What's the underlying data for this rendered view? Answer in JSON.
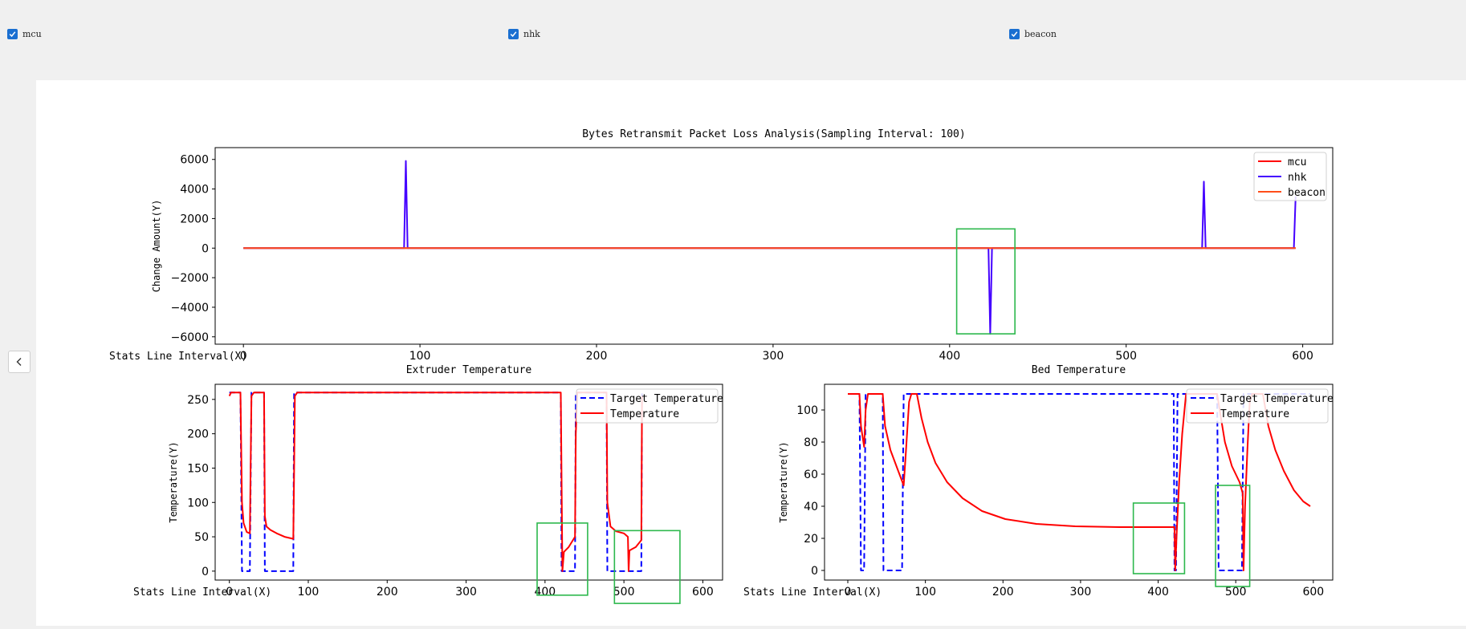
{
  "toolbar": {
    "checkboxes": [
      {
        "label": "mcu",
        "checked": true
      },
      {
        "label": "nhk",
        "checked": true
      },
      {
        "label": "beacon",
        "checked": true
      }
    ]
  },
  "collapse_icon": "chevron-left-icon",
  "colors": {
    "mcu": "#ff0000",
    "nhk": "#4400ff",
    "beacon": "#ff4d1a",
    "target": "#0000ff",
    "highlight": "#2db84d"
  },
  "chart_data": [
    {
      "type": "line",
      "title": "Bytes Retransmit Packet Loss Analysis(Sampling Interval: 100)",
      "xlabel": "Stats Line Interval(X)",
      "ylabel": "Change Amount(Y)",
      "xlim": [
        -16,
        617
      ],
      "ylim": [
        -6500,
        6800
      ],
      "xticks": [
        0,
        100,
        200,
        300,
        400,
        500,
        600
      ],
      "yticks": [
        -6000,
        -4000,
        -2000,
        0,
        2000,
        4000,
        6000
      ],
      "legend": "top-right",
      "series": [
        {
          "name": "mcu",
          "color": "#ff0000",
          "style": "solid",
          "points": [
            [
              0,
              0
            ],
            [
              596,
              0
            ]
          ]
        },
        {
          "name": "nhk",
          "color": "#4400ff",
          "style": "solid",
          "points": [
            [
              0,
              0
            ],
            [
              91,
              0
            ],
            [
              92,
              5900
            ],
            [
              93,
              0
            ],
            [
              422,
              0
            ],
            [
              423,
              -5800
            ],
            [
              424,
              0
            ],
            [
              543,
              0
            ],
            [
              544,
              4500
            ],
            [
              545,
              0
            ],
            [
              595,
              0
            ],
            [
              596,
              3500
            ]
          ]
        },
        {
          "name": "beacon",
          "color": "#ff4d1a",
          "style": "solid",
          "points": [
            [
              0,
              0
            ],
            [
              596,
              0
            ]
          ]
        }
      ],
      "highlights": [
        {
          "x0": 404,
          "x1": 437,
          "y0": -5800,
          "y1": 1300
        }
      ]
    },
    {
      "type": "line",
      "title": "Extruder Temperature",
      "xlabel": "Stats Line Interval(X)",
      "ylabel": "Temperature(Y)",
      "xlim": [
        -18,
        625
      ],
      "ylim": [
        -13,
        272
      ],
      "xticks": [
        0,
        100,
        200,
        300,
        400,
        500,
        600
      ],
      "yticks": [
        0,
        50,
        100,
        150,
        200,
        250
      ],
      "legend": "top-right",
      "series": [
        {
          "name": "Target Temperature",
          "color": "#0000ff",
          "style": "dashed",
          "points": [
            [
              0,
              260
            ],
            [
              14,
              260
            ],
            [
              16,
              0
            ],
            [
              26,
              0
            ],
            [
              28,
              260
            ],
            [
              44,
              260
            ],
            [
              45,
              0
            ],
            [
              81,
              0
            ],
            [
              82,
              260
            ],
            [
              420,
              260
            ],
            [
              421,
              0
            ],
            [
              438,
              0
            ],
            [
              439,
              260
            ],
            [
              478,
              260
            ],
            [
              479,
              0
            ],
            [
              522,
              0
            ],
            [
              523,
              260
            ]
          ]
        },
        {
          "name": "Temperature",
          "color": "#ff0000",
          "style": "solid",
          "points": [
            [
              0,
              255
            ],
            [
              2,
              260
            ],
            [
              14,
              260
            ],
            [
              16,
              100
            ],
            [
              18,
              70
            ],
            [
              22,
              57
            ],
            [
              26,
              55
            ],
            [
              28,
              255
            ],
            [
              31,
              260
            ],
            [
              44,
              260
            ],
            [
              45,
              80
            ],
            [
              47,
              65
            ],
            [
              52,
              60
            ],
            [
              60,
              55
            ],
            [
              70,
              50
            ],
            [
              81,
              47
            ],
            [
              82,
              140
            ],
            [
              83,
              255
            ],
            [
              86,
              260
            ],
            [
              420,
              260
            ],
            [
              422,
              0
            ],
            [
              424,
              28
            ],
            [
              430,
              35
            ],
            [
              438,
              50
            ],
            [
              439,
              200
            ],
            [
              441,
              260
            ],
            [
              478,
              260
            ],
            [
              479,
              100
            ],
            [
              483,
              65
            ],
            [
              490,
              58
            ],
            [
              500,
              55
            ],
            [
              505,
              50
            ],
            [
              506,
              0
            ],
            [
              507,
              30
            ],
            [
              510,
              32
            ],
            [
              515,
              35
            ],
            [
              522,
              45
            ],
            [
              523,
              255
            ]
          ]
        }
      ],
      "highlights": [
        {
          "x0": 390,
          "x1": 454,
          "y0": -35,
          "y1": 70
        },
        {
          "x0": 488,
          "x1": 571,
          "y0": -47,
          "y1": 59
        }
      ]
    },
    {
      "type": "line",
      "title": "Bed Temperature",
      "xlabel": "Stats Line Interval(X)",
      "ylabel": "Temperature(Y)",
      "xlim": [
        -30,
        625
      ],
      "ylim": [
        -6,
        116
      ],
      "xticks": [
        0,
        100,
        200,
        300,
        400,
        500,
        600
      ],
      "yticks": [
        0,
        20,
        40,
        60,
        80,
        100
      ],
      "legend": "top-right",
      "series": [
        {
          "name": "Target Temperature",
          "color": "#0000ff",
          "style": "dashed",
          "points": [
            [
              0,
              110
            ],
            [
              15,
              110
            ],
            [
              17,
              0
            ],
            [
              21,
              0
            ],
            [
              23,
              110
            ],
            [
              45,
              110
            ],
            [
              46,
              0
            ],
            [
              70,
              0
            ],
            [
              72,
              110
            ],
            [
              420,
              110
            ],
            [
              421,
              0
            ],
            [
              423,
              0
            ],
            [
              425,
              110
            ],
            [
              476,
              110
            ],
            [
              478,
              0
            ],
            [
              508,
              0
            ],
            [
              510,
              110
            ],
            [
              596,
              110
            ]
          ]
        },
        {
          "name": "Temperature",
          "color": "#ff0000",
          "style": "solid",
          "points": [
            [
              0,
              110
            ],
            [
              15,
              110
            ],
            [
              17,
              90
            ],
            [
              21,
              77
            ],
            [
              23,
              100
            ],
            [
              26,
              110
            ],
            [
              45,
              110
            ],
            [
              48,
              90
            ],
            [
              55,
              75
            ],
            [
              65,
              62
            ],
            [
              72,
              53
            ],
            [
              75,
              75
            ],
            [
              79,
              105
            ],
            [
              82,
              110
            ],
            [
              89,
              110
            ],
            [
              95,
              95
            ],
            [
              103,
              80
            ],
            [
              113,
              67
            ],
            [
              128,
              55
            ],
            [
              148,
              45
            ],
            [
              173,
              37
            ],
            [
              203,
              32
            ],
            [
              243,
              29
            ],
            [
              293,
              27.5
            ],
            [
              350,
              27
            ],
            [
              421,
              27
            ],
            [
              422,
              0
            ],
            [
              424,
              25
            ],
            [
              427,
              55
            ],
            [
              431,
              85
            ],
            [
              436,
              110
            ],
            [
              476,
              110
            ],
            [
              481,
              95
            ],
            [
              486,
              80
            ],
            [
              495,
              65
            ],
            [
              505,
              55
            ],
            [
              509,
              48
            ],
            [
              510,
              0
            ],
            [
              512,
              40
            ],
            [
              515,
              75
            ],
            [
              518,
              105
            ],
            [
              521,
              110
            ],
            [
              535,
              110
            ],
            [
              542,
              90
            ],
            [
              551,
              75
            ],
            [
              562,
              62
            ],
            [
              575,
              50
            ],
            [
              587,
              43
            ],
            [
              596,
              40
            ]
          ]
        }
      ],
      "highlights": [
        {
          "x0": 368,
          "x1": 434,
          "y0": -2,
          "y1": 42
        },
        {
          "x0": 474,
          "x1": 518,
          "y0": -10,
          "y1": 53
        }
      ]
    }
  ]
}
